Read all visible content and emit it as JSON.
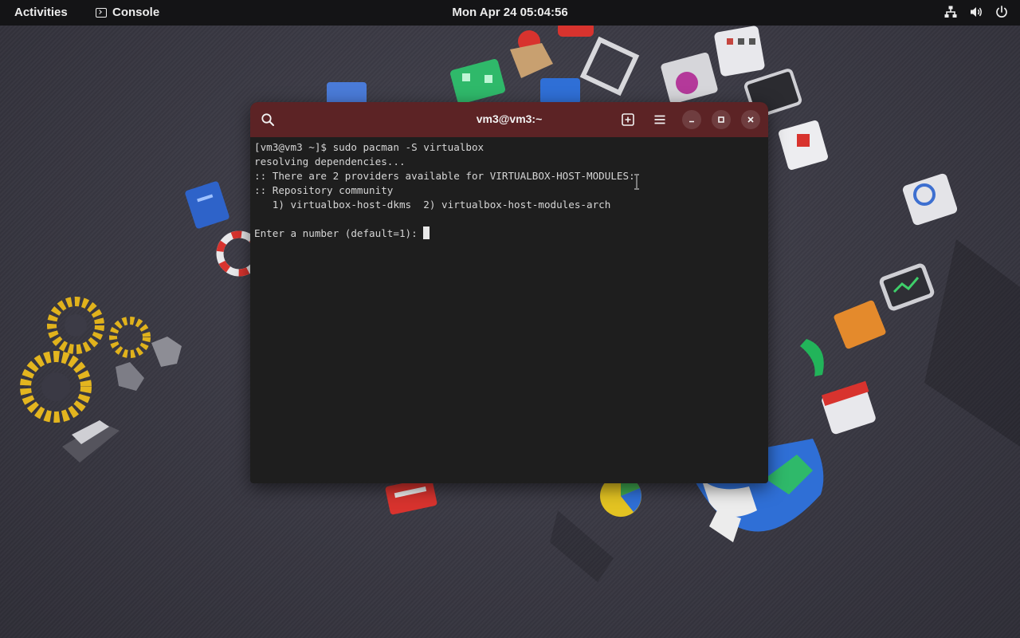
{
  "topbar": {
    "activities": "Activities",
    "app_name": "Console",
    "clock": "Mon Apr 24  05:04:56",
    "tray_icons": [
      "network-icon",
      "volume-icon",
      "power-icon"
    ]
  },
  "terminal": {
    "title": "vm3@vm3:~",
    "header_icons": [
      "search-icon",
      "new-tab-icon",
      "menu-icon",
      "minimize-icon",
      "maximize-icon",
      "close-icon"
    ],
    "lines": [
      "[vm3@vm3 ~]$ sudo pacman -S virtualbox",
      "resolving dependencies...",
      ":: There are 2 providers available for VIRTUALBOX-HOST-MODULES:",
      ":: Repository community",
      "   1) virtualbox-host-dkms  2) virtualbox-host-modules-arch",
      "",
      "Enter a number (default=1): "
    ]
  },
  "colors": {
    "topbar_bg": "#141416",
    "headerbar_bg": "#5c2325",
    "terminal_bg": "#1e1e1e",
    "terminal_text": "#d6d6d6"
  }
}
